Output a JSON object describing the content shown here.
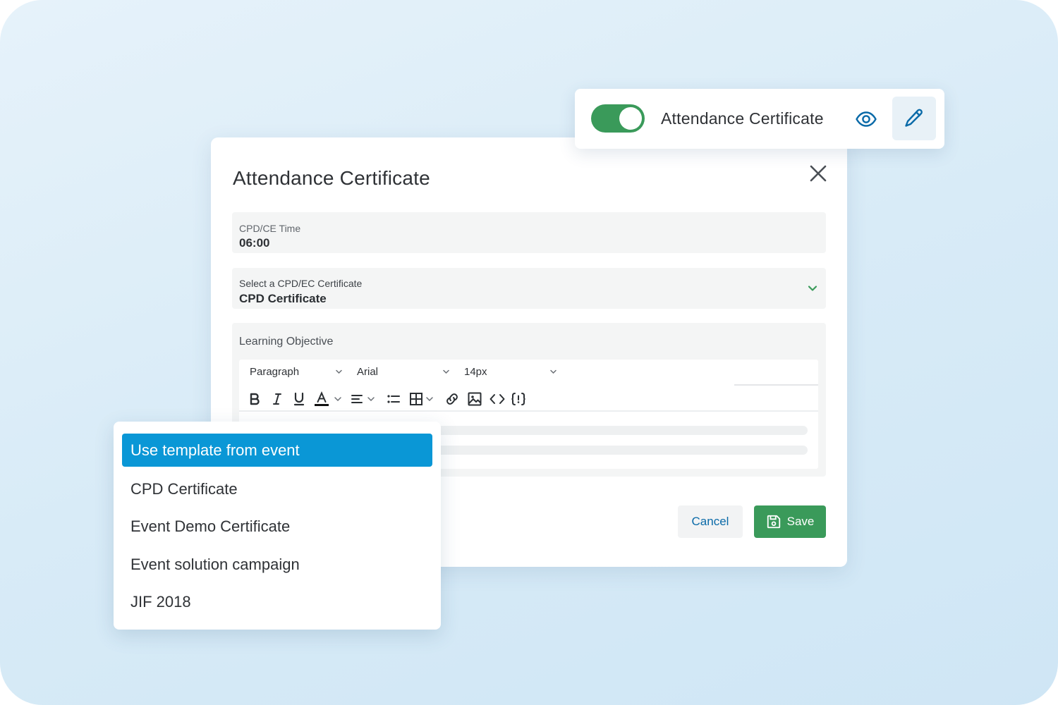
{
  "modal": {
    "title": "Attendance Certificate",
    "close_icon": "close-icon",
    "cpd_time": {
      "label": "CPD/CE Time",
      "value": "06:00"
    },
    "certificate_select": {
      "label": "Select a CPD/EC Certificate",
      "value": "CPD Certificate",
      "chevron_color": "#3a9a5a"
    },
    "learning_objective": {
      "label": "Learning Objective",
      "toolbar": {
        "block_format": "Paragraph",
        "font_family": "Arial",
        "font_size": "14px",
        "buttons": [
          "bold-icon",
          "italic-icon",
          "underline-icon",
          "text-color-icon",
          "align-icon",
          "list-icon",
          "table-icon",
          "link-icon",
          "image-icon",
          "code-icon",
          "variable-icon"
        ]
      }
    },
    "cancel_label": "Cancel",
    "save_label": "Save"
  },
  "top_card": {
    "toggle_on": true,
    "title": "Attendance Certificate",
    "preview_icon": "eye-icon",
    "edit_icon": "pencil-icon"
  },
  "dropdown": {
    "items": [
      {
        "label": "Use template from event",
        "selected": true
      },
      {
        "label": "CPD Certificate",
        "selected": false
      },
      {
        "label": "Event Demo Certificate",
        "selected": false
      },
      {
        "label": "Event solution campaign",
        "selected": false
      },
      {
        "label": "JIF 2018",
        "selected": false
      }
    ]
  },
  "colors": {
    "accent_green": "#3a9a5a",
    "accent_blue": "#0a97d6",
    "link_blue": "#0a6aa8"
  }
}
